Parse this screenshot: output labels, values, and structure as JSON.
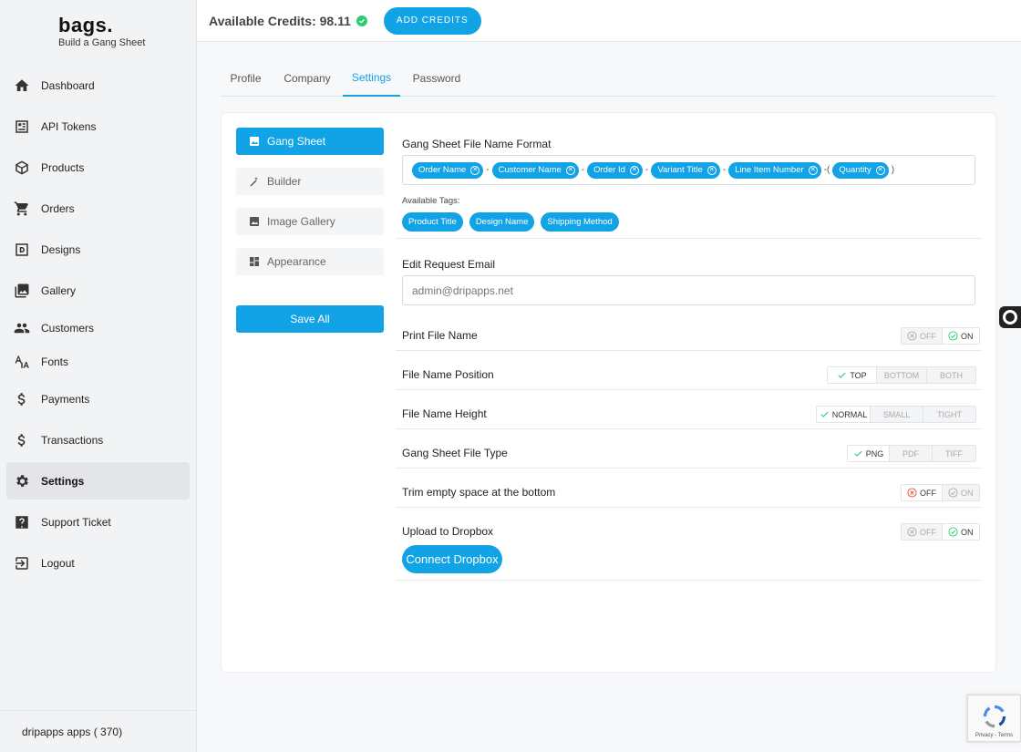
{
  "app": {
    "logo_name": "bags.",
    "logo_tagline": "Build a Gang Sheet"
  },
  "sidebar": {
    "items": [
      {
        "label": "Dashboard",
        "icon": "home-icon"
      },
      {
        "label": "API Tokens",
        "icon": "api-tokens-icon"
      },
      {
        "label": "Products",
        "icon": "products-box-icon"
      },
      {
        "label": "Orders",
        "icon": "cart-icon"
      },
      {
        "label": "Designs",
        "icon": "designs-icon"
      },
      {
        "label": "Gallery",
        "icon": "gallery-icon"
      },
      {
        "label": "Customers",
        "icon": "customers-icon"
      },
      {
        "label": "Fonts",
        "icon": "fonts-icon"
      },
      {
        "label": "Payments",
        "icon": "dollar-icon"
      },
      {
        "label": "Transactions",
        "icon": "dollar-icon"
      },
      {
        "label": "Settings",
        "icon": "gear-icon",
        "active": true
      },
      {
        "label": "Support Ticket",
        "icon": "help-icon"
      },
      {
        "label": "Logout",
        "icon": "logout-icon"
      }
    ],
    "footer": "dripapps apps ( 370)"
  },
  "topbar": {
    "credits_text": "Available Credits: 98.11",
    "add_credits_label": "ADD CREDITS"
  },
  "tabs": [
    "Profile",
    "Company",
    "Settings",
    "Password"
  ],
  "active_tab": "Settings",
  "settings_menu": {
    "items": [
      "Gang Sheet",
      "Builder",
      "Image Gallery",
      "Appearance"
    ],
    "active": "Gang Sheet",
    "save_label": "Save All"
  },
  "gang_sheet": {
    "file_name_format_label": "Gang Sheet File Name Format",
    "format_tags": [
      "Order Name",
      "Customer Name",
      "Order Id",
      "Variant Title",
      "Line Item Number",
      "Quantity"
    ],
    "separators": [
      "-",
      "-",
      "-",
      "-",
      "-(",
      ")"
    ],
    "available_tags_label": "Available Tags:",
    "available_tags": [
      "Product Title",
      "Design Name",
      "Shipping Method"
    ],
    "edit_email_label": "Edit Request Email",
    "edit_email_placeholder": "admin@dripapps.net",
    "rows": {
      "print_file_name": {
        "label": "Print File Name",
        "options": [
          "OFF",
          "ON"
        ],
        "selected": "ON"
      },
      "file_name_position": {
        "label": "File Name Position",
        "options": [
          "TOP",
          "BOTTOM",
          "BOTH"
        ],
        "selected": "TOP"
      },
      "file_name_height": {
        "label": "File Name Height",
        "options": [
          "NORMAL",
          "SMALL",
          "TIGHT"
        ],
        "selected": "NORMAL"
      },
      "file_type": {
        "label": "Gang Sheet File Type",
        "options": [
          "PNG",
          "PDF",
          "TIFF"
        ],
        "selected": "PNG"
      },
      "trim_space": {
        "label": "Trim empty space at the bottom",
        "options": [
          "OFF",
          "ON"
        ],
        "selected": "OFF"
      },
      "upload_dropbox": {
        "label": "Upload to Dropbox",
        "options": [
          "OFF",
          "ON"
        ],
        "selected": "ON"
      }
    },
    "connect_dropbox_label": "Connect Dropbox"
  },
  "recaptcha": {
    "text": "Privacy - Terms"
  },
  "colors": {
    "accent": "#12a3e6",
    "success": "#2ecc71",
    "danger": "#e74c3c"
  }
}
